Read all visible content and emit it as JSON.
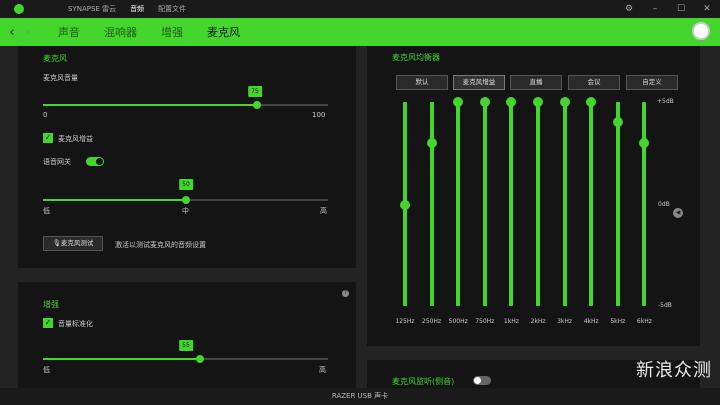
{
  "titlebar": {
    "items": [
      "SYNAPSE 雷云",
      "音频",
      "配置文件"
    ],
    "active_index": 1,
    "controls": [
      "gear-icon",
      "minimize-icon",
      "maximize-icon",
      "close-icon"
    ]
  },
  "navbar": {
    "tabs": [
      "声音",
      "混响器",
      "增强",
      "麦克风"
    ],
    "active_index": 3
  },
  "mic_panel": {
    "title": "麦克风",
    "volume": {
      "label": "麦克风音量",
      "value": "75",
      "min": "0",
      "max": "100",
      "fraction": 0.75
    },
    "boost": {
      "label": "麦克风增益",
      "checked": true
    },
    "sidetone": {
      "label": "语音网关",
      "on": true
    },
    "gate": {
      "value": "50",
      "low": "低",
      "mid": "中",
      "high": "高",
      "fraction": 0.5
    },
    "test": {
      "button": "麦克风测试",
      "hint": "激活以测试麦克风的音频设置"
    }
  },
  "enhance_panel": {
    "title": "增强",
    "normalize": {
      "label": "音量标准化",
      "checked": true
    },
    "slider": {
      "value": "55",
      "low": "低",
      "high": "高",
      "fraction": 0.55
    },
    "help": "?"
  },
  "eq_panel": {
    "title": "麦克风均衡器",
    "presets": [
      "默认",
      "麦克风增益",
      "直播",
      "会议",
      "自定义"
    ],
    "active_preset": 1,
    "scale": {
      "top": "+5dB",
      "mid": "0dB",
      "bottom": "-5dB"
    },
    "bands": [
      {
        "freq": "125Hz",
        "db": -0.05
      },
      {
        "freq": "250Hz",
        "db": 3.0
      },
      {
        "freq": "500Hz",
        "db": 5.0
      },
      {
        "freq": "750Hz",
        "db": 5.0
      },
      {
        "freq": "1kHz",
        "db": 5.0
      },
      {
        "freq": "2kHz",
        "db": 5.0
      },
      {
        "freq": "3kHz",
        "db": 5.0
      },
      {
        "freq": "4kHz",
        "db": 5.0
      },
      {
        "freq": "5kHz",
        "db": 4.0
      },
      {
        "freq": "6kHz",
        "db": 3.0
      }
    ]
  },
  "bottom_panel": {
    "label": "麦克风监听(侧音)",
    "on": false
  },
  "statusbar": {
    "device": "RAZER USB 声卡"
  },
  "watermark": "新浪众测",
  "colors": {
    "accent": "#44d62c",
    "panel": "#141414",
    "background": "#232323"
  }
}
